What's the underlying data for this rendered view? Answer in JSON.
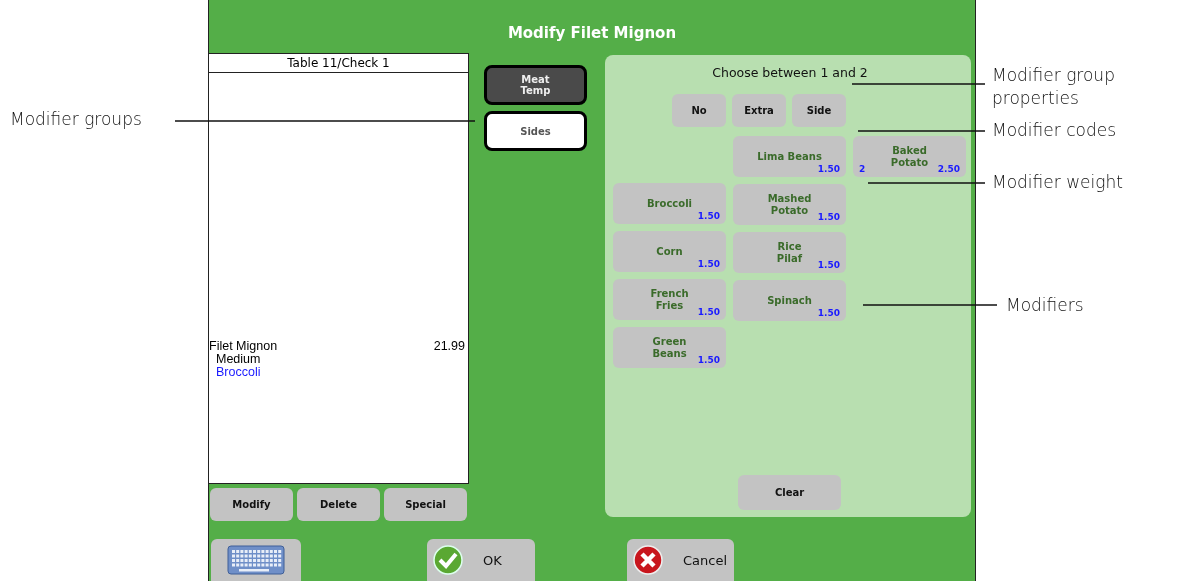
{
  "window": {
    "title": "Modify Filet Mignon"
  },
  "check": {
    "header": "Table 11/Check 1",
    "items": [
      {
        "name": "Filet Mignon",
        "price": "21.99",
        "modifiers": [
          {
            "name": "Medium",
            "color": "#000000"
          },
          {
            "name": "Broccoli",
            "color": "#1a1aff"
          }
        ]
      }
    ]
  },
  "check_actions": [
    "Modify",
    "Delete",
    "Special"
  ],
  "groups": [
    {
      "label": "Meat Temp",
      "selected": true
    },
    {
      "label": "Sides",
      "selected": false
    }
  ],
  "modifier_panel": {
    "prompt": "Choose between 1 and 2",
    "codes": [
      "No",
      "Extra",
      "Side"
    ],
    "columns": [
      [
        {
          "kind": "blank"
        },
        {
          "kind": "modifier",
          "name": "Broccoli",
          "price": "1.50"
        },
        {
          "kind": "modifier",
          "name": "Corn",
          "price": "1.50"
        },
        {
          "kind": "modifier",
          "name": "French\nFries",
          "price": "1.50"
        },
        {
          "kind": "modifier",
          "name": "Green\nBeans",
          "price": "1.50"
        }
      ],
      [
        {
          "kind": "modifier",
          "name": "Lima Beans",
          "price": "1.50"
        },
        {
          "kind": "modifier",
          "name": "Mashed\nPotato",
          "price": "1.50"
        },
        {
          "kind": "modifier",
          "name": "Rice\nPilaf",
          "price": "1.50"
        },
        {
          "kind": "modifier",
          "name": "Spinach",
          "price": "1.50"
        }
      ],
      [
        {
          "kind": "modifier",
          "name": "Baked\nPotato",
          "price": "2.50",
          "weight": "2"
        }
      ]
    ],
    "clear": "Clear"
  },
  "footer": {
    "ok": "OK",
    "cancel": "Cancel"
  },
  "left_callouts": [
    "Modifier groups"
  ],
  "right_callouts": [
    "Modifier group properties",
    "Modifier codes",
    "Modifier weight",
    "Modifiers"
  ]
}
